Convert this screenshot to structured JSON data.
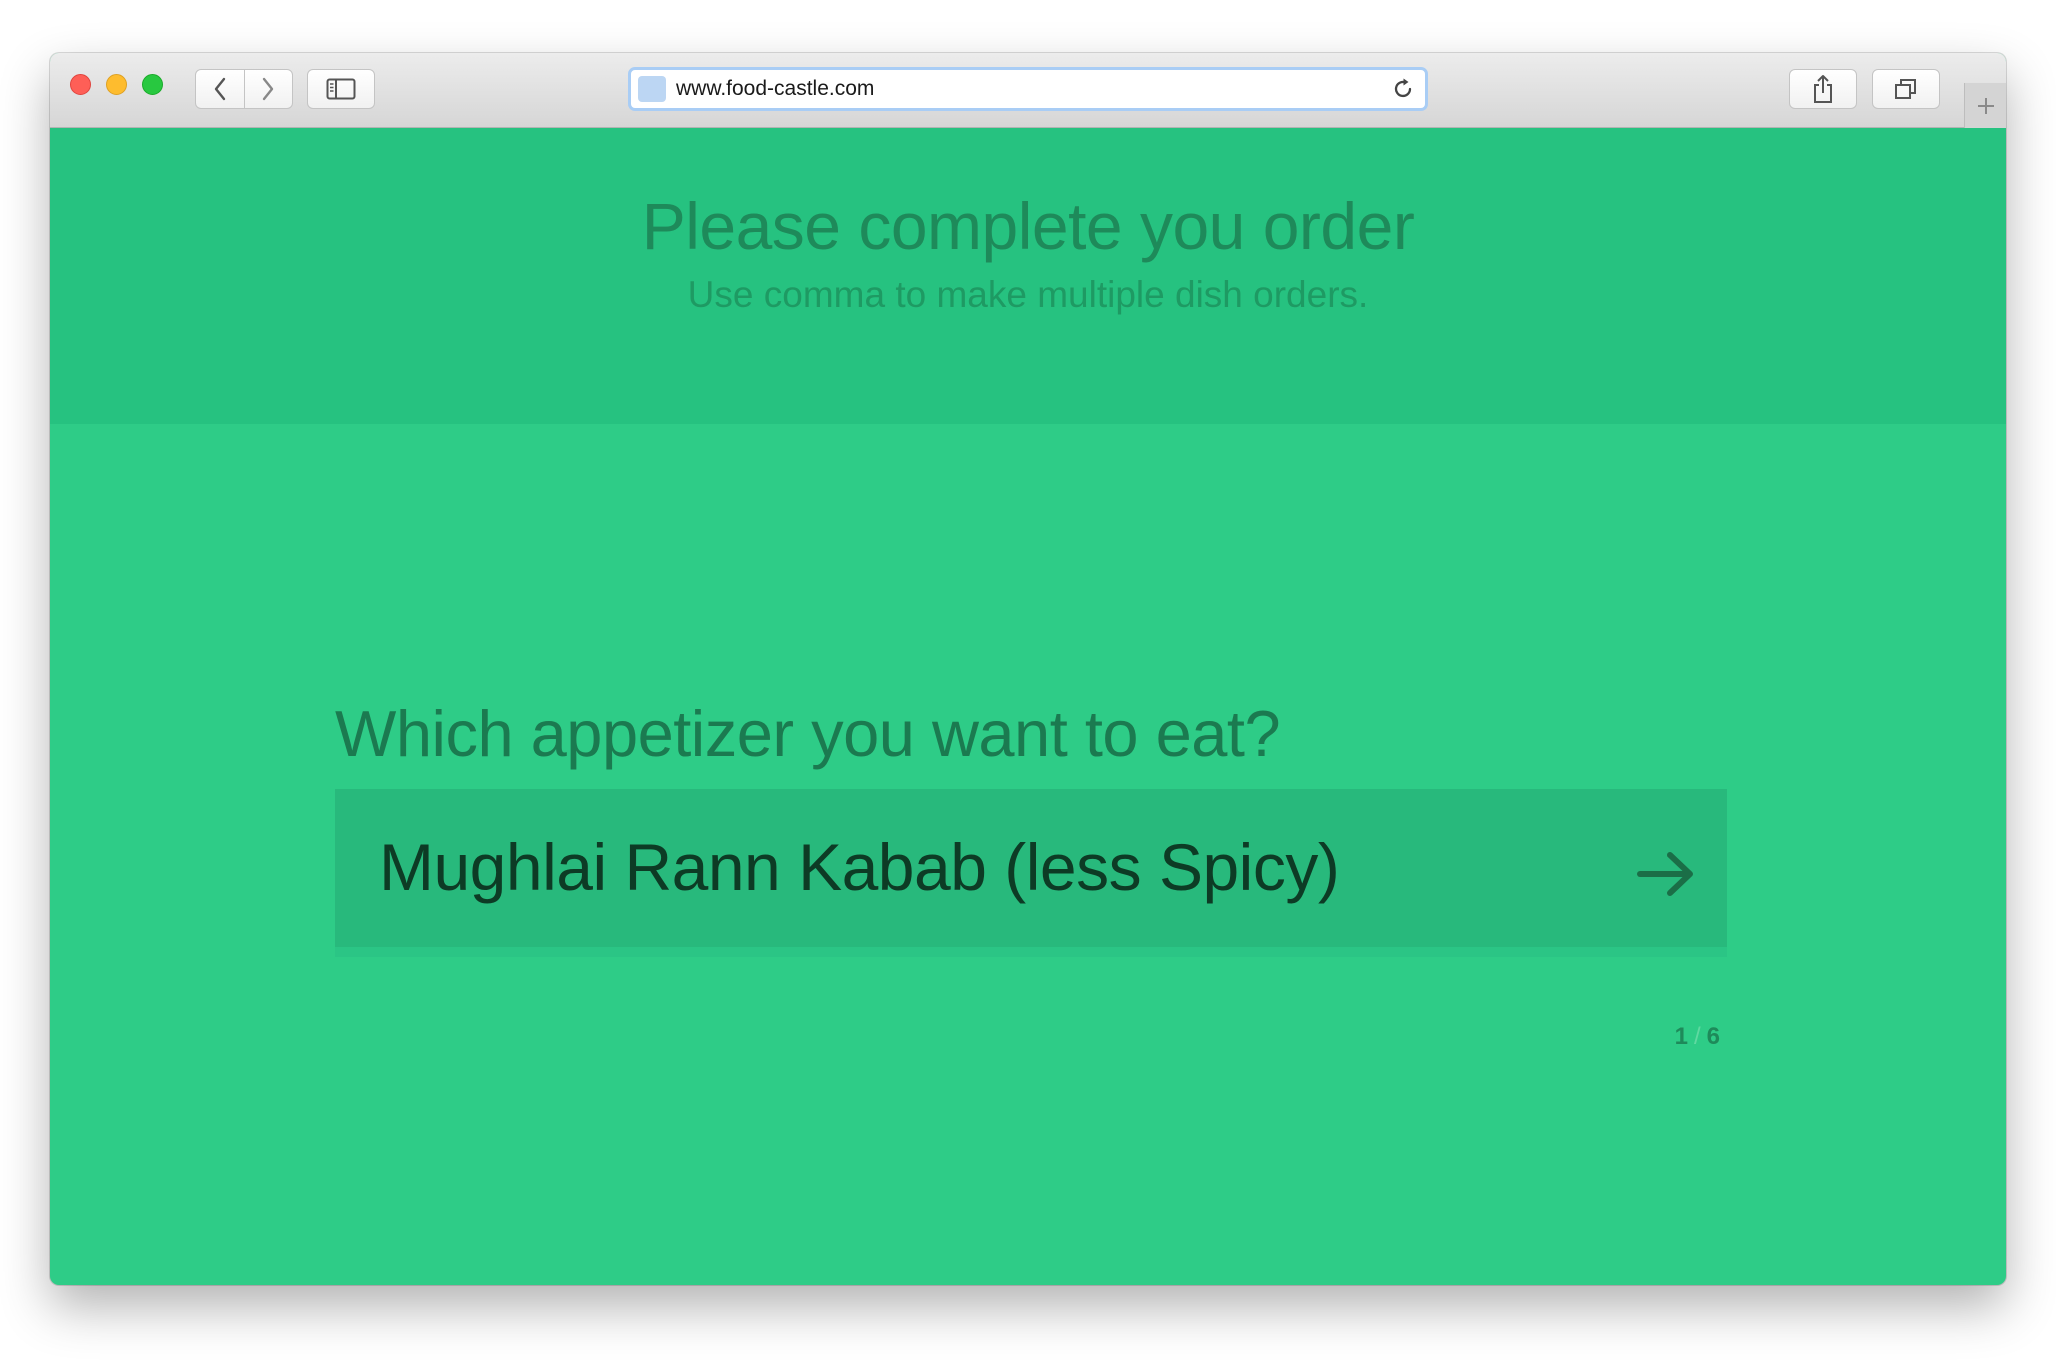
{
  "browser": {
    "url": "www.food-castle.com"
  },
  "header": {
    "title": "Please complete you order",
    "subtitle": "Use comma to make multiple dish orders."
  },
  "form": {
    "question": "Which appetizer you want to eat?",
    "answer": "Mughlai Rann Kabab (less Spicy)",
    "progress": {
      "current": "1",
      "separator": "/",
      "total": "6"
    }
  },
  "colors": {
    "page_background": "#2ecc87",
    "header_background": "#26c280",
    "input_background": "#28b97c",
    "accent_dark": "#1e8a5a"
  },
  "icons": {
    "back": "chevron-left-icon",
    "forward": "chevron-right-icon",
    "sidebar": "sidebar-icon",
    "reload": "reload-icon",
    "share": "share-icon",
    "tabs": "tabs-icon",
    "new_tab": "plus-icon",
    "submit": "arrow-right-icon"
  }
}
